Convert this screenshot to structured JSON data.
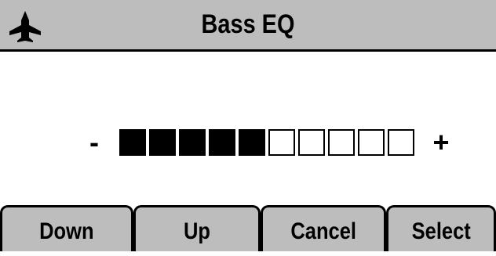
{
  "header": {
    "title": "Bass EQ",
    "app_icon": "airplane-icon"
  },
  "eq": {
    "minus_label": "-",
    "plus_label": "+",
    "level": 5,
    "max_level": 10
  },
  "softkeys": [
    {
      "label": "Down"
    },
    {
      "label": "Up"
    },
    {
      "label": "Cancel"
    },
    {
      "label": "Select"
    }
  ],
  "colors": {
    "title_bar": "#bdbdbd",
    "softkey_bg": "#bdbdbd",
    "segment_filled": "#000000",
    "segment_empty": "#ffffff"
  }
}
